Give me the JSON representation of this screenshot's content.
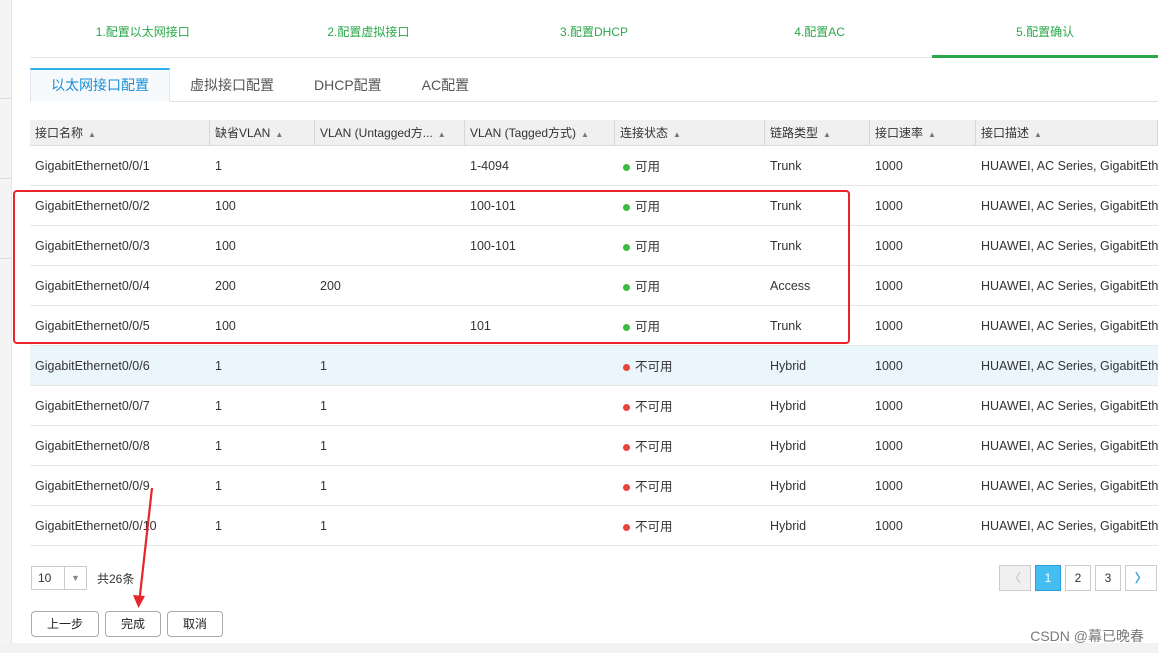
{
  "steps": [
    "1.配置以太网接口",
    "2.配置虚拟接口",
    "3.配置DHCP",
    "4.配置AC",
    "5.配置确认"
  ],
  "tabs": [
    "以太网接口配置",
    "虚拟接口配置",
    "DHCP配置",
    "AC配置"
  ],
  "columns": [
    "接口名称",
    "缺省VLAN",
    "VLAN (Untagged方...",
    "VLAN (Tagged方式)",
    "连接状态",
    "链路类型",
    "接口速率",
    "接口描述"
  ],
  "rows": [
    {
      "name": "GigabitEthernet0/0/1",
      "pvid": "1",
      "untagged": "",
      "tagged": "1-4094",
      "status": "可用",
      "type": "Trunk",
      "speed": "1000",
      "desc": "HUAWEI, AC Series, GigabitEth"
    },
    {
      "name": "GigabitEthernet0/0/2",
      "pvid": "100",
      "untagged": "",
      "tagged": "100-101",
      "status": "可用",
      "type": "Trunk",
      "speed": "1000",
      "desc": "HUAWEI, AC Series, GigabitEth"
    },
    {
      "name": "GigabitEthernet0/0/3",
      "pvid": "100",
      "untagged": "",
      "tagged": "100-101",
      "status": "可用",
      "type": "Trunk",
      "speed": "1000",
      "desc": "HUAWEI, AC Series, GigabitEth"
    },
    {
      "name": "GigabitEthernet0/0/4",
      "pvid": "200",
      "untagged": "200",
      "tagged": "",
      "status": "可用",
      "type": "Access",
      "speed": "1000",
      "desc": "HUAWEI, AC Series, GigabitEth"
    },
    {
      "name": "GigabitEthernet0/0/5",
      "pvid": "100",
      "untagged": "",
      "tagged": "101",
      "status": "可用",
      "type": "Trunk",
      "speed": "1000",
      "desc": "HUAWEI, AC Series, GigabitEth"
    },
    {
      "name": "GigabitEthernet0/0/6",
      "pvid": "1",
      "untagged": "1",
      "tagged": "",
      "status": "不可用",
      "type": "Hybrid",
      "speed": "1000",
      "desc": "HUAWEI, AC Series, GigabitEth"
    },
    {
      "name": "GigabitEthernet0/0/7",
      "pvid": "1",
      "untagged": "1",
      "tagged": "",
      "status": "不可用",
      "type": "Hybrid",
      "speed": "1000",
      "desc": "HUAWEI, AC Series, GigabitEth"
    },
    {
      "name": "GigabitEthernet0/0/8",
      "pvid": "1",
      "untagged": "1",
      "tagged": "",
      "status": "不可用",
      "type": "Hybrid",
      "speed": "1000",
      "desc": "HUAWEI, AC Series, GigabitEth"
    },
    {
      "name": "GigabitEthernet0/0/9",
      "pvid": "1",
      "untagged": "1",
      "tagged": "",
      "status": "不可用",
      "type": "Hybrid",
      "speed": "1000",
      "desc": "HUAWEI, AC Series, GigabitEth"
    },
    {
      "name": "GigabitEthernet0/0/10",
      "pvid": "1",
      "untagged": "1",
      "tagged": "",
      "status": "不可用",
      "type": "Hybrid",
      "speed": "1000",
      "desc": "HUAWEI, AC Series, GigabitEth"
    }
  ],
  "pager": {
    "page_size": "10",
    "total": "共26条",
    "pages": [
      "1",
      "2",
      "3"
    ],
    "current": "1"
  },
  "buttons": {
    "prev_step": "上一步",
    "finish": "完成",
    "cancel": "取消"
  },
  "watermark": "CSDN @幕已晚春",
  "colors": {
    "accent_green": "#2aa84a",
    "ok": "#3dbb47",
    "bad": "#e8453c",
    "annotation_red": "#e8252b"
  }
}
